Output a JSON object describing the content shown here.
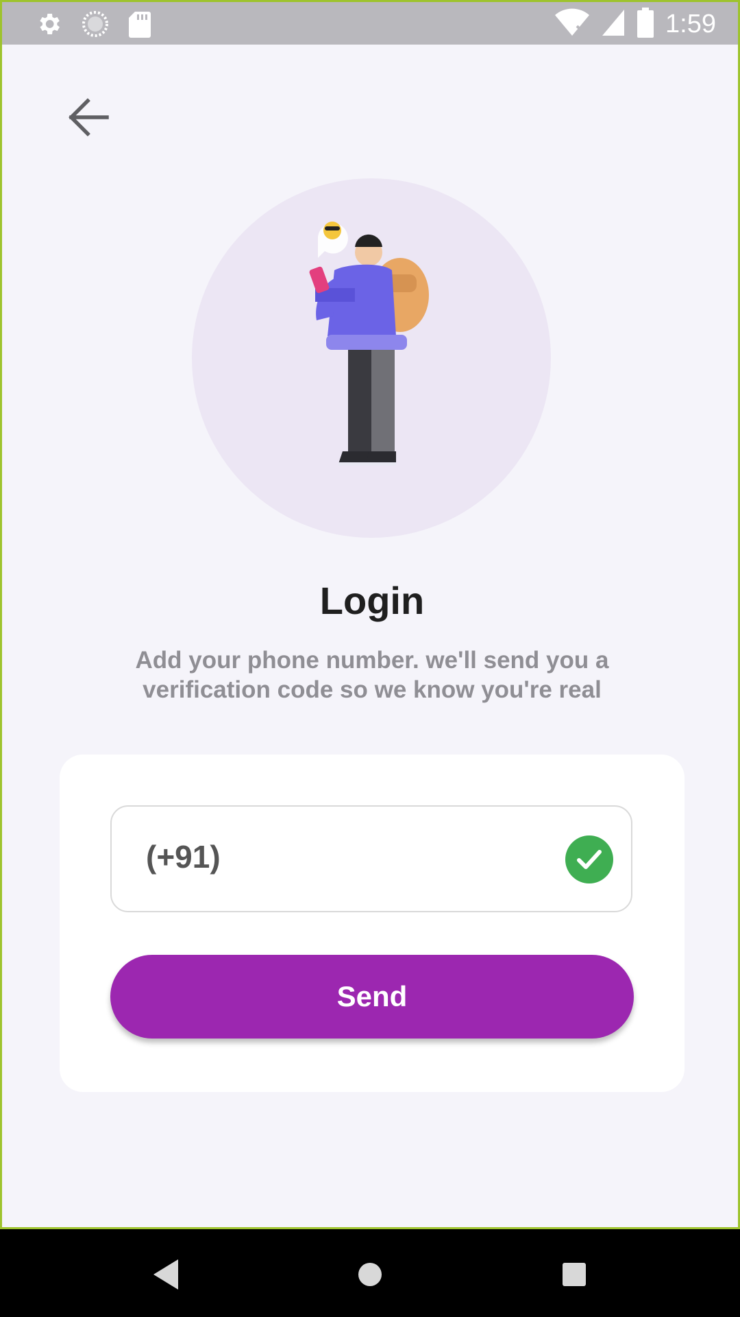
{
  "status_bar": {
    "time": "1:59",
    "icons": [
      "settings-icon",
      "sync-icon",
      "sd-card-icon",
      "wifi-off-icon",
      "signal-icon",
      "battery-icon"
    ]
  },
  "header": {
    "back_icon": "arrow-left-icon"
  },
  "login": {
    "title": "Login",
    "subtitle": "Add your phone number. we'll send you a verification code so we know you're real"
  },
  "form": {
    "phone_value": "(+91)",
    "valid_icon": "check-circle-icon",
    "send_label": "Send"
  },
  "colors": {
    "accent": "#9c27b0",
    "valid": "#3fae52",
    "background": "#f5f4fa"
  },
  "nav_bar": {
    "icons": [
      "back-triangle-icon",
      "home-circle-icon",
      "recents-square-icon"
    ]
  }
}
